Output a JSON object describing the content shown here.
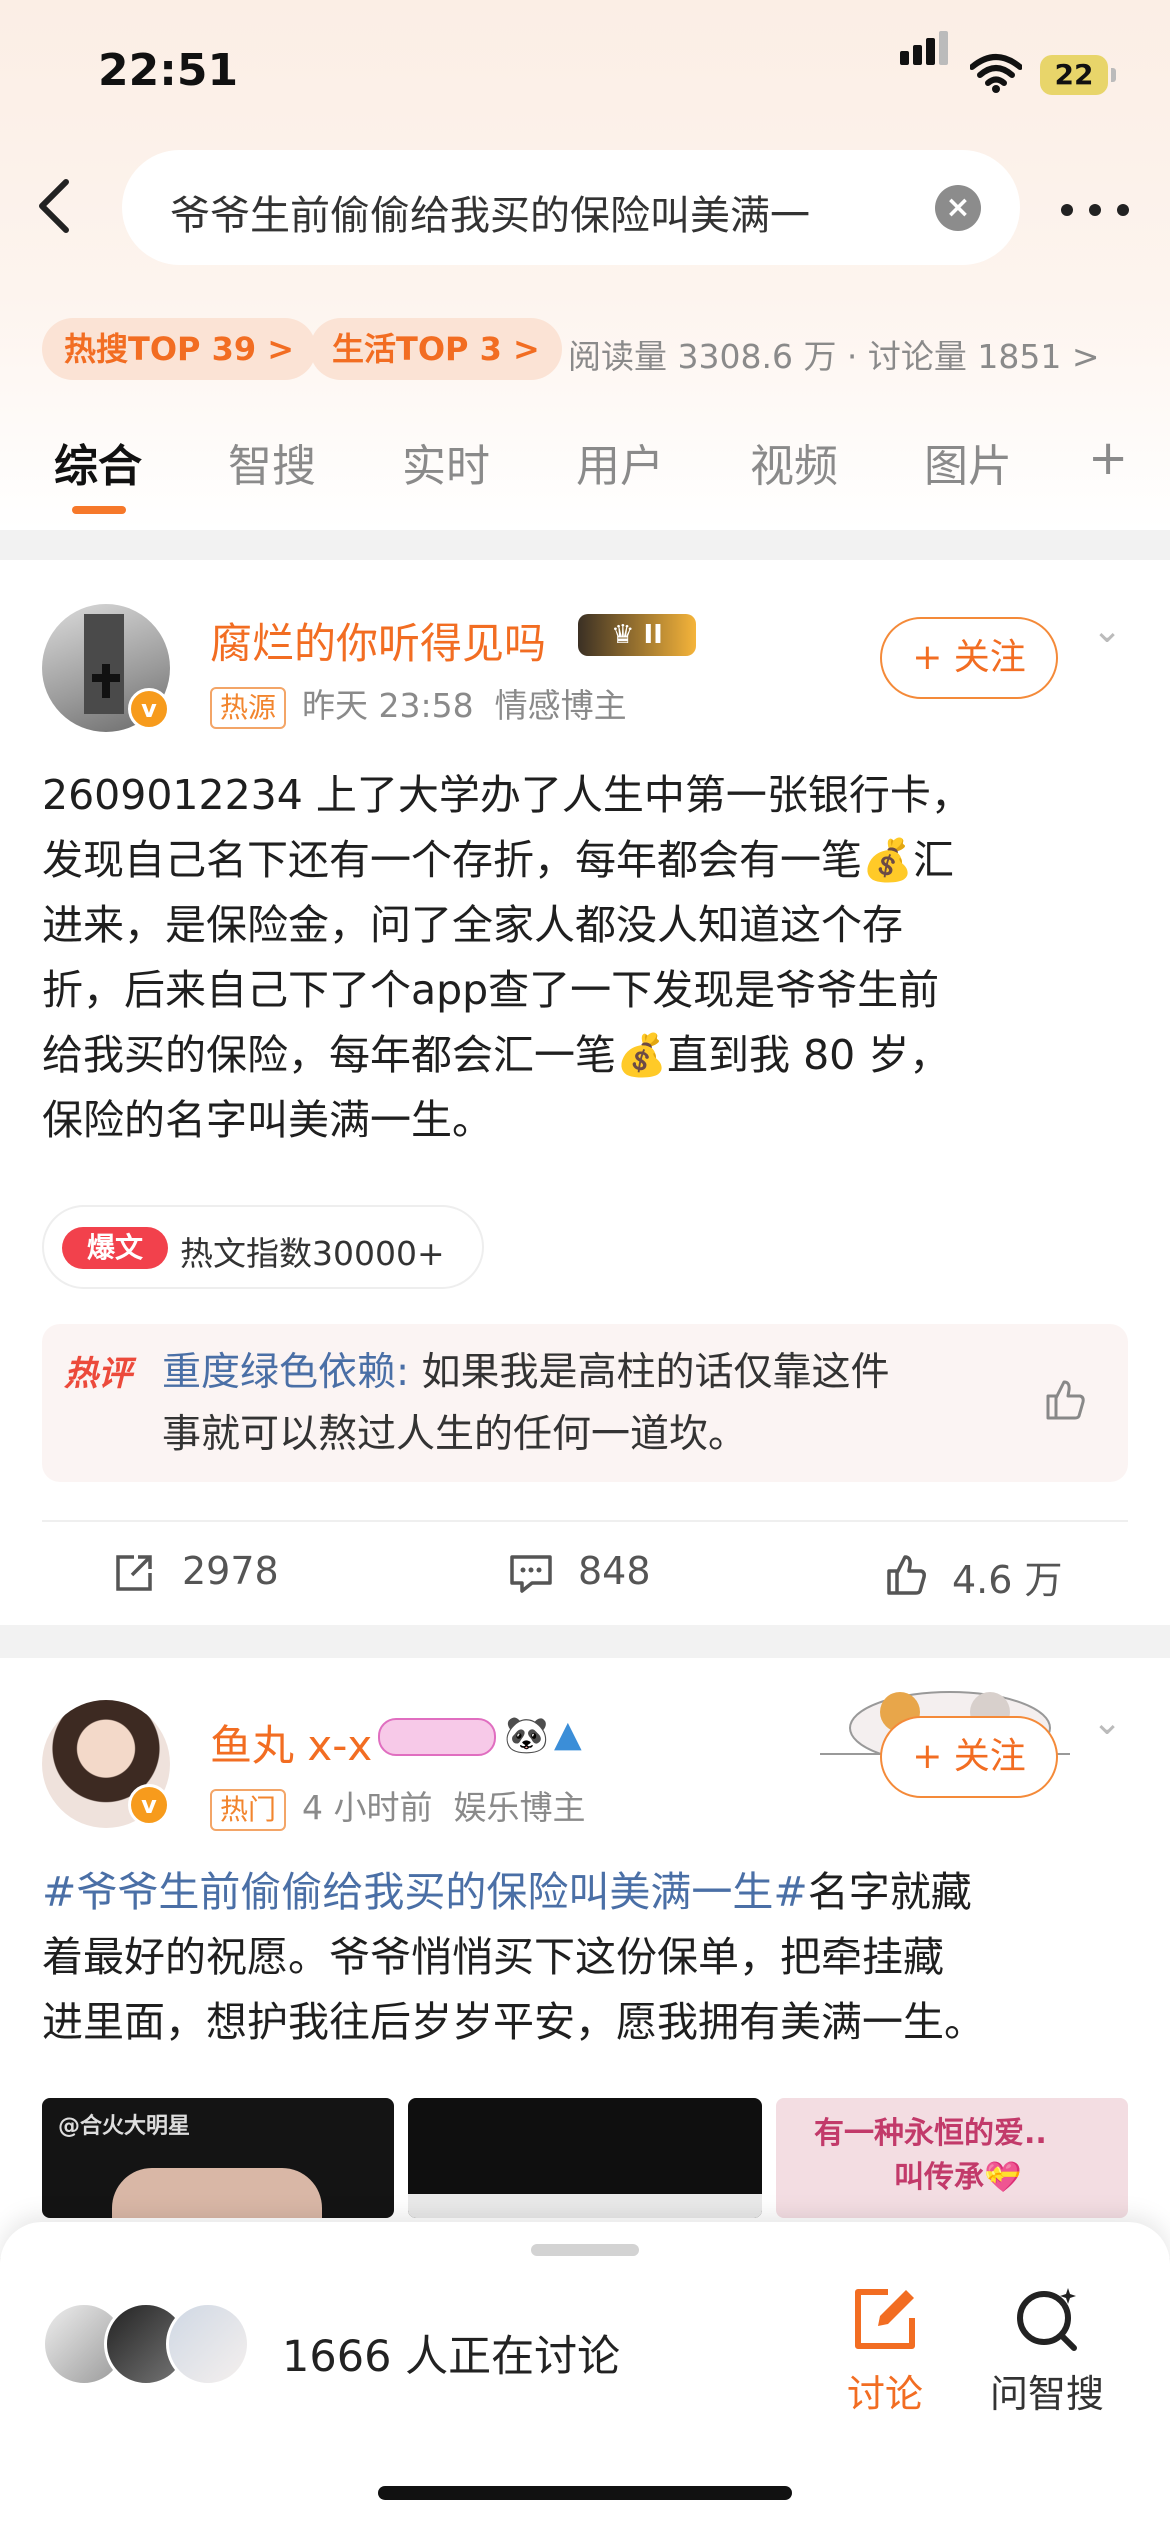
{
  "status_bar": {
    "time": "22:51",
    "battery": "22"
  },
  "search": {
    "query": "爷爷生前偷偷给我买的保险叫美满一"
  },
  "chips": [
    {
      "label": "热搜TOP 39 >"
    },
    {
      "label": "生活TOP 3 >"
    }
  ],
  "topic_stats": "阅读量 3308.6 万 · 讨论量 1851 >",
  "tabs": [
    "综合",
    "智搜",
    "实时",
    "用户",
    "视频",
    "图片",
    "+"
  ],
  "post1": {
    "username": "腐烂的你听得见吗",
    "rank_badge": "II",
    "tag": "热源",
    "time": "昨天 23:58",
    "category": "情感博主",
    "follow_label": "+ 关注",
    "lines": [
      "2609012234 上了大学办了人生中第一张银行卡，",
      "发现自己名下还有一个存折，每年都会有一笔💰汇",
      "进来，是保险金，问了全家人都没人知道这个存",
      "折，后来自己下了个app查了一下发现是爷爷生前",
      "给我买的保险，每年都会汇一笔💰直到我 80 岁，",
      "保险的名字叫美满一生。"
    ],
    "hot_badge": "爆文",
    "hot_index": "热文指数30000+",
    "hot_comment_label": "热评",
    "hot_comment_user": "重度绿色依赖:",
    "hot_comment_line1": " 如果我是高柱的话仅靠这件",
    "hot_comment_line2": "事就可以熬过人生的任何一道坎。",
    "reposts": "2978",
    "comments": "848",
    "likes": "4.6 万"
  },
  "post2": {
    "username": "鱼丸 x-x",
    "tag": "热门",
    "time": "4 小时前",
    "category": "娱乐博主",
    "follow_label": "+ 关注",
    "hashtag": "#爷爷生前偷偷给我买的保险叫美满一生#",
    "line1_rest": "名字就藏",
    "line2": "着最好的祝愿。爷爷悄悄买下这份保单，把牵挂藏",
    "line3": "进里面，想护我往后岁岁平安，愿我拥有美满一生。",
    "thumb1_text": "@合火大明星",
    "thumb3_line1": "有一种永恒的爱..",
    "thumb3_line2": "叫传承💝"
  },
  "bottom_sheet": {
    "discussing": "1666 人正在讨论",
    "discuss_label": "讨论",
    "ask_label": "问智搜"
  },
  "colors": {
    "accent": "#f26d22",
    "link": "#4a6fa6"
  }
}
